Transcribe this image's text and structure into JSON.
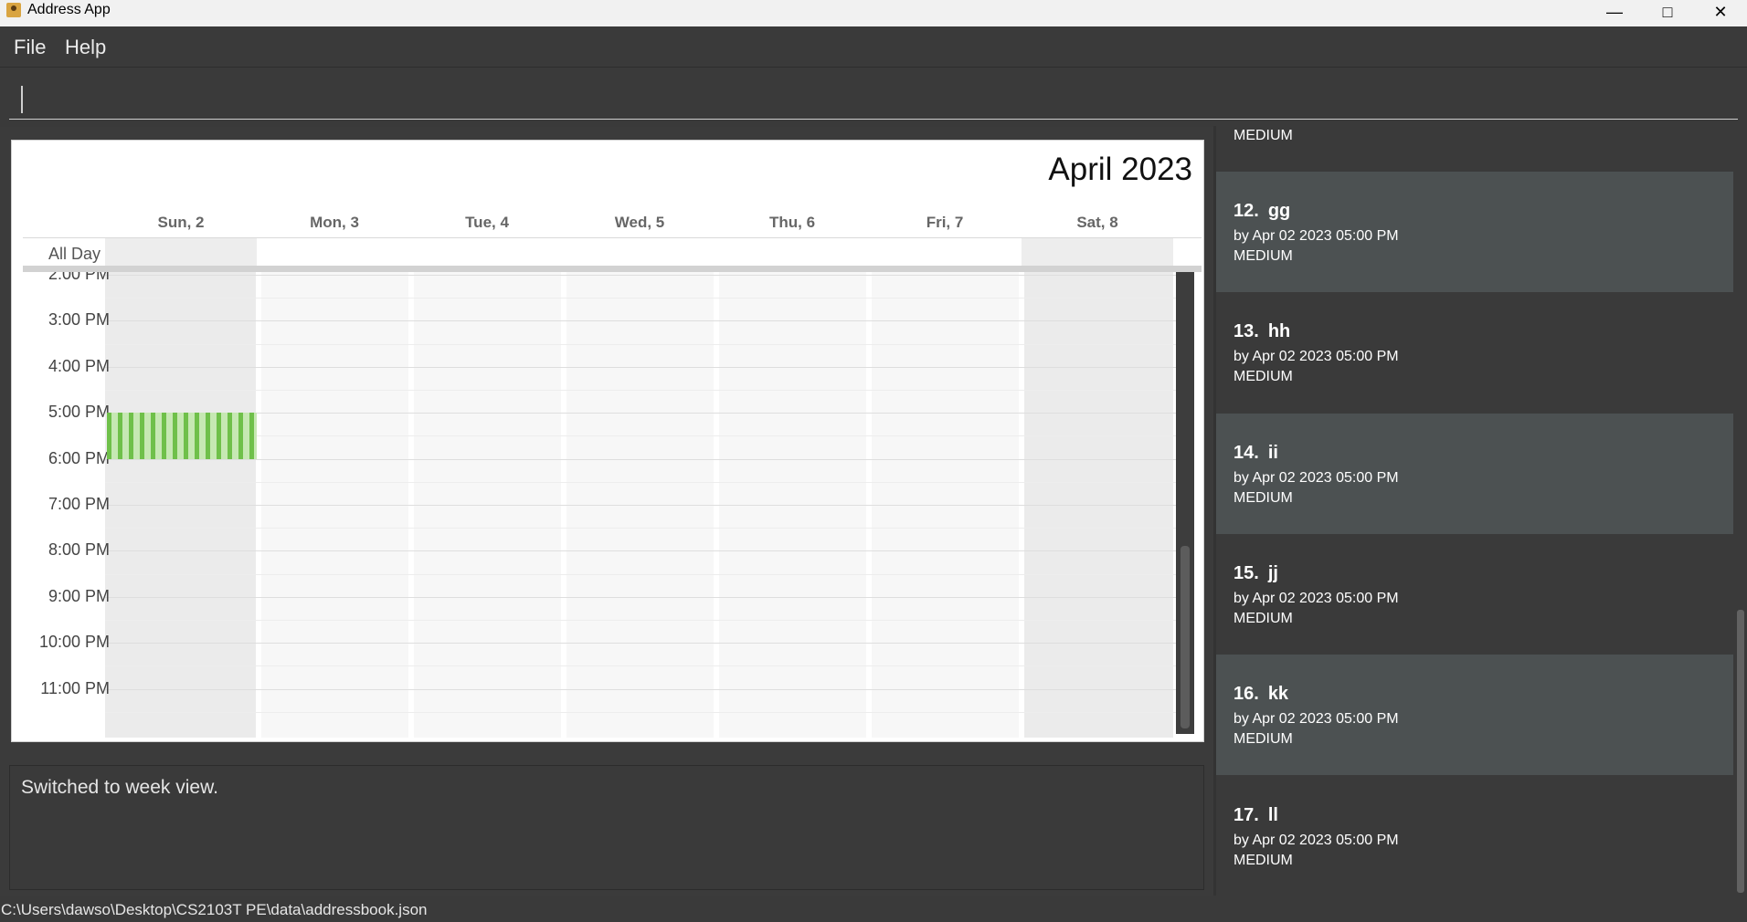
{
  "window": {
    "title": "Address App"
  },
  "menu": {
    "file": "File",
    "help": "Help"
  },
  "command": {
    "value": ""
  },
  "calendar": {
    "month": "April 2023",
    "all_day": "All Day",
    "days": [
      "Sun, 2",
      "Mon, 3",
      "Tue, 4",
      "Wed, 5",
      "Thu, 6",
      "Fri, 7",
      "Sat, 8"
    ],
    "times": [
      "2:00 PM",
      "3:00 PM",
      "4:00 PM",
      "5:00 PM",
      "6:00 PM",
      "7:00 PM",
      "8:00 PM",
      "9:00 PM",
      "10:00 PM",
      "11:00 PM"
    ],
    "event": {
      "day": "Sun, 2",
      "start": "5:00 PM",
      "end": "6:00 PM",
      "color": "#6fc04a"
    }
  },
  "result": {
    "message": "Switched to week view."
  },
  "tasks": {
    "partial_top_priority": "MEDIUM",
    "items": [
      {
        "index": "12.",
        "name": "gg",
        "deadline": "by Apr 02 2023 05:00 PM",
        "priority": "MEDIUM"
      },
      {
        "index": "13.",
        "name": "hh",
        "deadline": "by Apr 02 2023 05:00 PM",
        "priority": "MEDIUM"
      },
      {
        "index": "14.",
        "name": "ii",
        "deadline": "by Apr 02 2023 05:00 PM",
        "priority": "MEDIUM"
      },
      {
        "index": "15.",
        "name": "jj",
        "deadline": "by Apr 02 2023 05:00 PM",
        "priority": "MEDIUM"
      },
      {
        "index": "16.",
        "name": "kk",
        "deadline": "by Apr 02 2023 05:00 PM",
        "priority": "MEDIUM"
      },
      {
        "index": "17.",
        "name": "ll",
        "deadline": "by Apr 02 2023 05:00 PM",
        "priority": "MEDIUM"
      }
    ]
  },
  "status": {
    "path": "C:\\Users\\dawso\\Desktop\\CS2103T PE\\data\\addressbook.json"
  },
  "icons": {
    "app": "address-book-icon",
    "minimize": "minimize-icon",
    "maximize": "maximize-icon",
    "close": "close-icon"
  }
}
